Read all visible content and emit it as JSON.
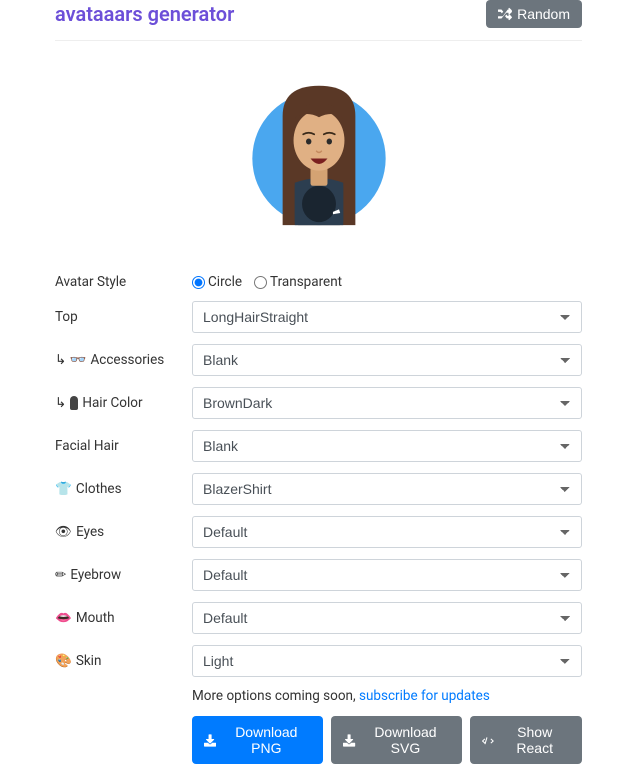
{
  "header": {
    "title": "avataaars generator",
    "random_label": "Random"
  },
  "avatarStyle": {
    "label": "Avatar Style",
    "options": {
      "circle": "Circle",
      "transparent": "Transparent"
    },
    "selected": "circle"
  },
  "fields": {
    "top": {
      "label": "Top",
      "icon": "",
      "value": "LongHairStraight"
    },
    "accessories": {
      "label": "Accessories",
      "icon": "↳ 👓",
      "value": "Blank"
    },
    "hairColor": {
      "label": "Hair Color",
      "icon": "↳",
      "value": "BrownDark"
    },
    "facialHair": {
      "label": "Facial Hair",
      "icon": "",
      "value": "Blank"
    },
    "clothes": {
      "label": "Clothes",
      "icon": "👕",
      "value": "BlazerShirt"
    },
    "eyes": {
      "label": "Eyes",
      "icon": "👁",
      "value": "Default"
    },
    "eyebrow": {
      "label": "Eyebrow",
      "icon": "✏",
      "value": "Default"
    },
    "mouth": {
      "label": "Mouth",
      "icon": "👄",
      "value": "Default"
    },
    "skin": {
      "label": "Skin",
      "icon": "🎨",
      "value": "Light"
    }
  },
  "footer": {
    "more_text": "More options coming soon, ",
    "subscribe_text": "subscribe for updates",
    "download_png": "Download PNG",
    "download_svg": "Download SVG",
    "show_react": "Show React"
  }
}
